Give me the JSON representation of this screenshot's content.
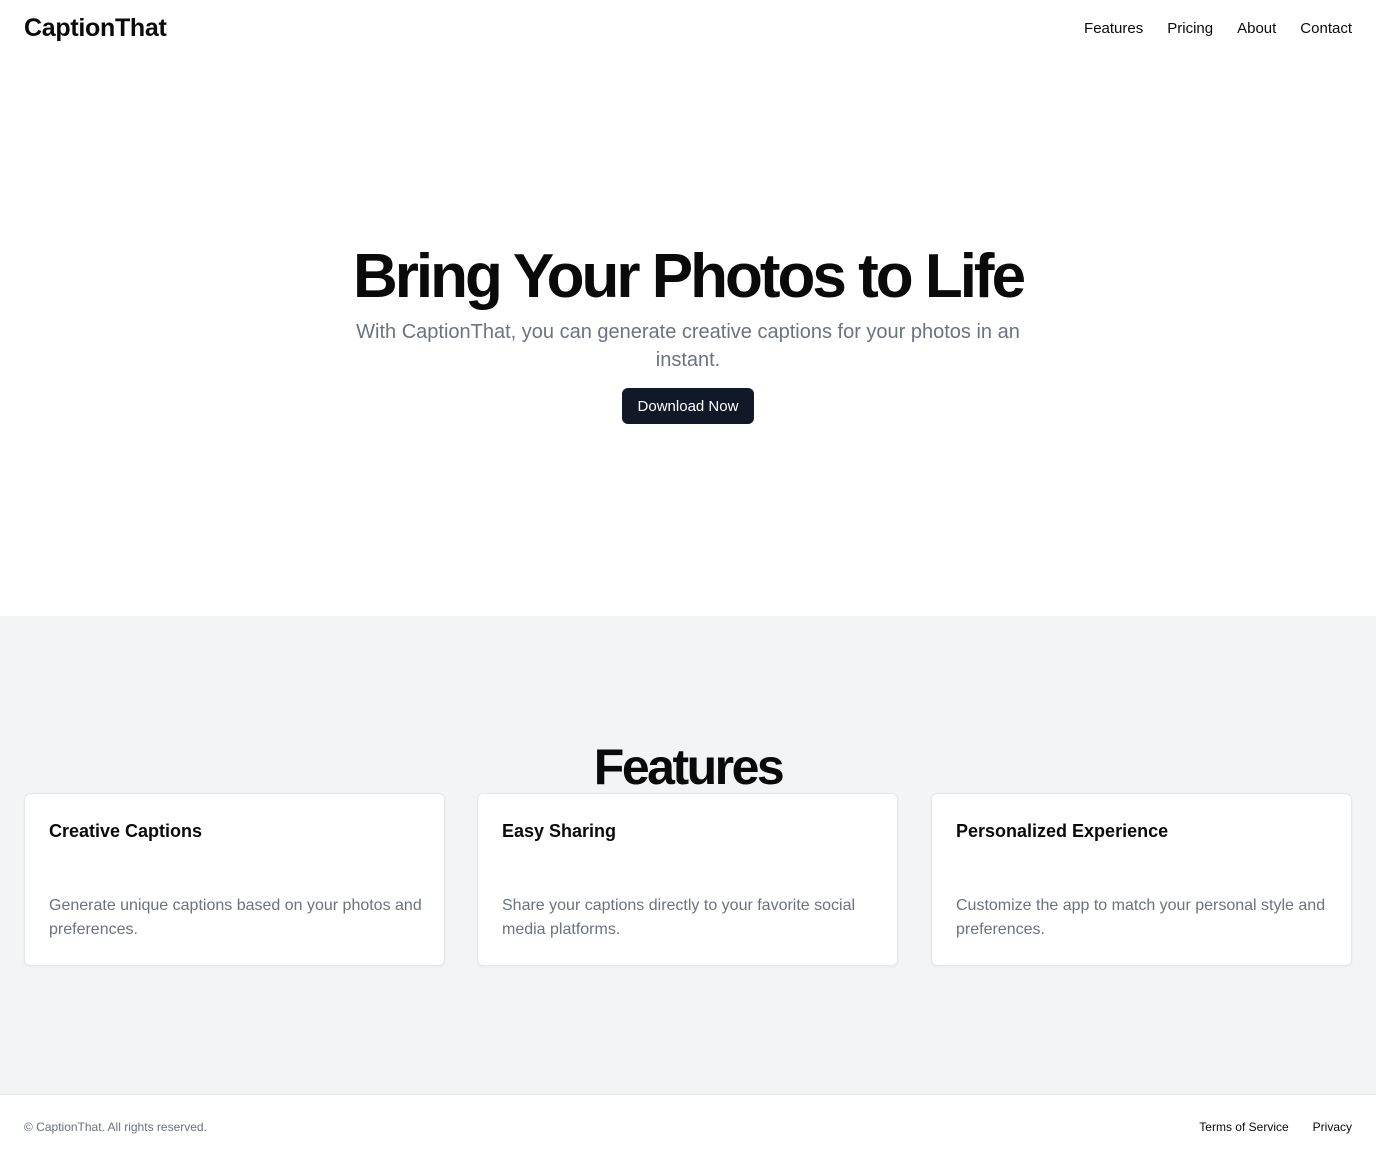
{
  "header": {
    "brand": "CaptionThat",
    "nav": [
      "Features",
      "Pricing",
      "About",
      "Contact"
    ]
  },
  "hero": {
    "title": "Bring Your Photos to Life",
    "subtitle": "With CaptionThat, you can generate creative captions for your photos in an instant.",
    "cta_label": "Download Now"
  },
  "features": {
    "heading": "Features",
    "cards": [
      {
        "title": "Creative Captions",
        "description": "Generate unique captions based on your photos and preferences."
      },
      {
        "title": "Easy Sharing",
        "description": "Share your captions directly to your favorite social media platforms."
      },
      {
        "title": "Personalized Experience",
        "description": "Customize the app to match your personal style and preferences."
      }
    ]
  },
  "footer": {
    "copyright": "© CaptionThat. All rights reserved.",
    "links": [
      "Terms of Service",
      "Privacy"
    ]
  },
  "colors": {
    "primary_button": "#111827",
    "muted_text": "#6b7280",
    "section_background": "#f3f4f6"
  }
}
